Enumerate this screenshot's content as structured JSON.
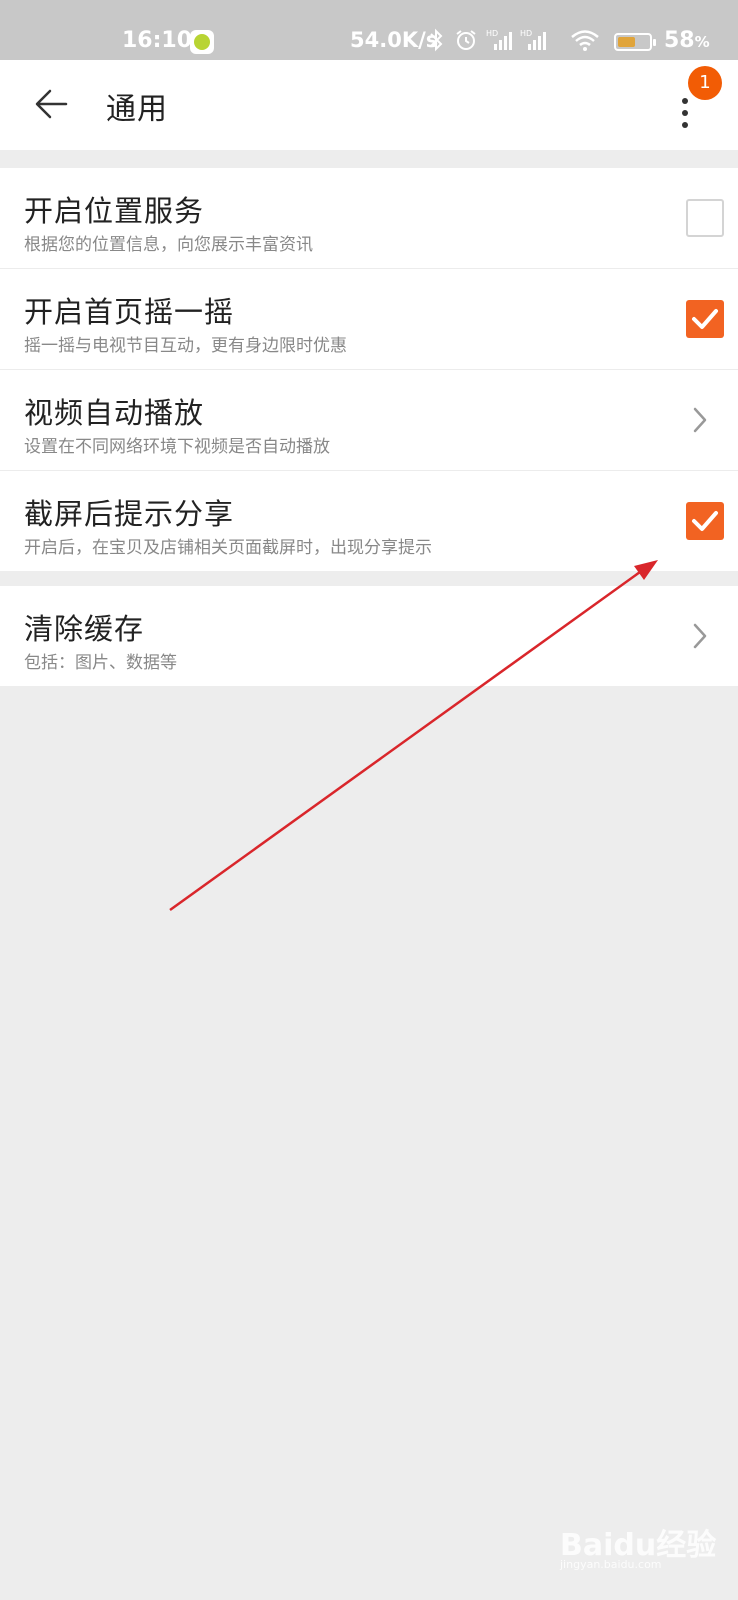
{
  "status_bar": {
    "time": "16:10",
    "net_speed": "54.0K/s",
    "battery_pct": "58",
    "battery_unit": "%",
    "battery_level": 0.58,
    "icons": [
      "app-icon",
      "bluetooth-icon",
      "alarm-icon",
      "signal-hd-icon",
      "signal-hd-icon",
      "wifi-icon",
      "battery-icon"
    ]
  },
  "header": {
    "title": "通用",
    "badge_count": "1"
  },
  "settings": {
    "location": {
      "title": "开启位置服务",
      "subtitle": "根据您的位置信息，向您展示丰富资讯",
      "checked": false
    },
    "shake": {
      "title": "开启首页摇一摇",
      "subtitle": "摇一摇与电视节目互动，更有身边限时优惠",
      "checked": true
    },
    "video": {
      "title": "视频自动播放",
      "subtitle": "设置在不同网络环境下视频是否自动播放"
    },
    "screenshot": {
      "title": "截屏后提示分享",
      "subtitle": "开启后，在宝贝及店铺相关页面截屏时，出现分享提示",
      "checked": true
    },
    "cache": {
      "title": "清除缓存",
      "subtitle": "包括：图片、数据等"
    }
  },
  "colors": {
    "accent": "#f26322",
    "badge": "#f25c05",
    "background": "#ededed",
    "annotation_arrow": "#d9262b"
  },
  "watermark": {
    "brand": "Baidu经验",
    "domain": "jingyan.baidu.com"
  }
}
